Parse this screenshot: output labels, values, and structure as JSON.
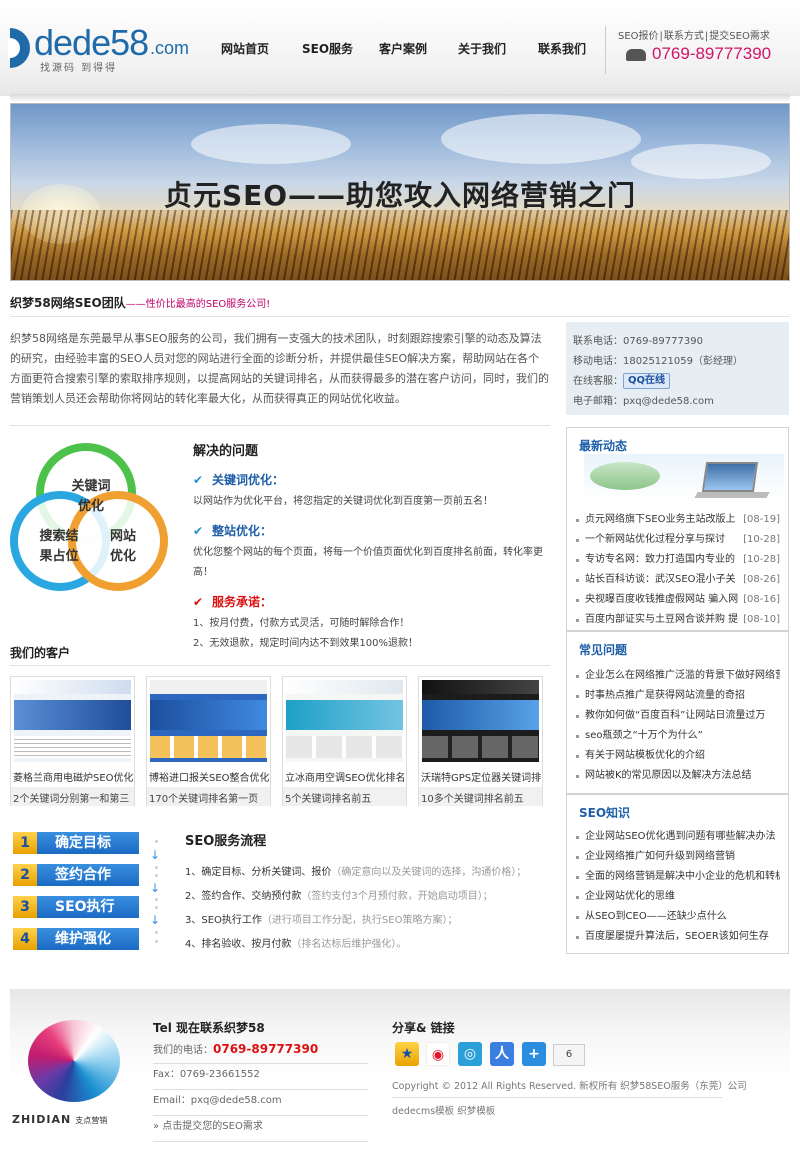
{
  "header": {
    "logo_text": "dede58",
    "logo_tld": ".com",
    "logo_slogan": "找源码 到得得",
    "nav": [
      "网站首页",
      "SEO服务",
      "客户案例",
      "关于我们",
      "联系我们"
    ],
    "top_links": [
      "SEO报价",
      "|",
      "联系方式",
      "|",
      "提交SEO需求"
    ],
    "phone": "0769-89777390"
  },
  "banner": {
    "title": "贞元SEO——助您攻入网络营销之门"
  },
  "team": {
    "title": "织梦58网络SEO团队",
    "tagline": "——性价比最高的SEO服务公司!",
    "intro": "织梦58网络是东莞最早从事SEO服务的公司，我们拥有一支强大的技术团队，时刻跟踪搜索引擎的动态及算法的研究，由经验丰富的SEO人员对您的网站进行全面的诊断分析，并提供最佳SEO解决方案，帮助网站在各个方面更符合搜索引擎的索取排序规则，以提高网站的关键词排名，从而获得最多的潜在客户访问，同时，我们的营销策划人员还会帮助你将网站的转化率最大化，从而获得真正的网站优化收益。"
  },
  "contact": {
    "tel": "联系电话：0769-89777390",
    "mobile": "移动电话：18025121059（彭经理）",
    "qq_label": "在线客服：",
    "qq_button": "QQ在线",
    "email": "电子邮箱：pxq@dede58.com"
  },
  "circles": {
    "top": [
      "关键词",
      "优化"
    ],
    "left": [
      "搜索结",
      "果占位"
    ],
    "right": [
      "网站",
      "优化"
    ]
  },
  "problems": {
    "title": "解决的问题",
    "items": [
      {
        "head": "关键词优化：",
        "text": "以网站作为优化平台，将您指定的关键词优化到百度第一页前五名！"
      },
      {
        "head": "整站优化：",
        "text": "优化您整个网站的每个页面，将每一个价值页面优化到百度排名前面，转化率更高！"
      }
    ],
    "promise_head": "服务承诺：",
    "promise_lines": [
      "1、按月付费，付款方式灵活，可随时解除合作！",
      "2、无效退款，规定时间内达不到效果100%退款！"
    ]
  },
  "clients": {
    "title": "我们的客户",
    "items": [
      {
        "caption": "菱格兰商用电磁炉SEO优化",
        "sub": "2个关键词分别第一和第三"
      },
      {
        "caption": "博裕进口报关SEO整合优化",
        "sub": "170个关键词排名第一页"
      },
      {
        "caption": "立冰商用空调SEO优化排名",
        "sub": "5个关键词排名前五"
      },
      {
        "caption": "沃瑞特GPS定位器关键词排",
        "sub": "10多个关键词排名前五"
      }
    ]
  },
  "steps": [
    {
      "num": "1",
      "label": "确定目标"
    },
    {
      "num": "2",
      "label": "签约合作"
    },
    {
      "num": "3",
      "label": "SEO执行"
    },
    {
      "num": "4",
      "label": "维护强化"
    }
  ],
  "flow": {
    "title": "SEO服务流程",
    "items": [
      {
        "main": "1、确定目标、分析关键词、报价",
        "note": "（确定意向以及关键词的选择，沟通价格）；"
      },
      {
        "main": "2、签约合作、交纳预付款",
        "note": "（签约支付3个月预付款，开始启动项目）；"
      },
      {
        "main": "3、SEO执行工作",
        "note": "（进行项目工作分配，执行SEO策略方案）；"
      },
      {
        "main": "4、排名验收、按月付款",
        "note": "（排名达标后维护强化）。"
      }
    ]
  },
  "news": {
    "title": "最新动态",
    "items": [
      {
        "text": "贞元网络旗下SEO业务主站改版上",
        "date": "[08-19]"
      },
      {
        "text": "一个新网站优化过程分享与探讨",
        "date": "[10-28]"
      },
      {
        "text": "专访专名网：致力打造国内专业的",
        "date": "[10-28]"
      },
      {
        "text": "站长百科访谈：武汉SEO混小子关",
        "date": "[08-26]"
      },
      {
        "text": "央视曝百度收钱推虚假网站 骗入网",
        "date": "[08-16]"
      },
      {
        "text": "百度内部证实与土豆网合谈并购 提",
        "date": "[08-10]"
      }
    ]
  },
  "faq": {
    "title": "常见问题",
    "items": [
      "企业怎么在网络推广泛滥的背景下做好网络营",
      "时事热点推广是获得网站流量的奇招",
      "教你如何做“百度百科”让网站日流量过万",
      "seo瓶颈之“十万个为什么”",
      "有关于网站模板优化的介绍",
      "网站被K的常见原因以及解决方法总结"
    ]
  },
  "seo_knowledge": {
    "title": "SEO知识",
    "items": [
      "企业网站SEO优化遇到问题有哪些解决办法",
      "企业网络推广如何升级到网络营销",
      "全面的网络营销是解决中小企业的危机和转机",
      "企业网站优化的思维",
      "从SEO到CEO——还缺少点什么",
      "百度屡屡提升算法后，SEOER该如何生存"
    ]
  },
  "footer": {
    "logo_text": "ZHIDIAN",
    "logo_sub": "支点营销",
    "tel_title": "Tel 现在联系织梦58",
    "tel_label": "我们的电话：",
    "tel_value": "0769-89777390",
    "fax": "Fax：0769-23661552",
    "email": "Email：pxq@dede58.com",
    "submit": "» 点击提交您的SEO需求",
    "share_title": "分享& 链接",
    "share_count": "6",
    "copyright": "Copyright © 2012 All Rights Reserved. 新权所有 织梦58SEO服务（东莞）公司",
    "templates": "dedecms模板 织梦模板"
  },
  "colors": {
    "brand_blue": "#1e5fa8",
    "phone_pink": "#d2156a",
    "accent_red": "#dd1111"
  }
}
